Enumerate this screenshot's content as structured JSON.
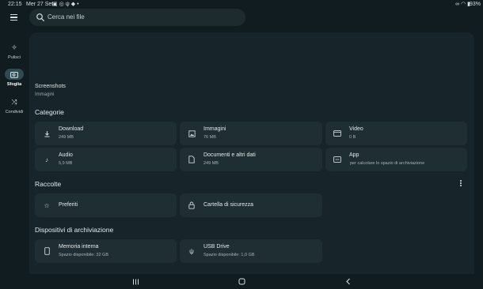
{
  "status_bar": {
    "time": "22:15",
    "date": "Mer 27 Set",
    "battery": "93%"
  },
  "search": {
    "placeholder": "Cerca nei file"
  },
  "rail": {
    "items": [
      {
        "label": "Pulisci",
        "icon": "sparkles-icon"
      },
      {
        "label": "Sfoglia",
        "icon": "browse-folder-icon",
        "active": true
      },
      {
        "label": "Condividi",
        "icon": "share-icon"
      }
    ]
  },
  "screenshots": {
    "title": "Screenshots",
    "subtitle": "Immagini"
  },
  "categorie": {
    "title": "Categorie",
    "items": [
      {
        "label": "Download",
        "sub": "249 MB",
        "icon": "download-icon"
      },
      {
        "label": "Immagini",
        "sub": "76 MB",
        "icon": "image-icon"
      },
      {
        "label": "Video",
        "sub": "0 B",
        "icon": "video-icon"
      },
      {
        "label": "Audio",
        "sub": "5,9 MB",
        "icon": "music-note-icon"
      },
      {
        "label": "Documenti e altri dati",
        "sub": "249 MB",
        "icon": "document-icon"
      },
      {
        "label": "App",
        "sub": "per calcolare lo spazio di archiviazione",
        "icon": "app-icon"
      }
    ]
  },
  "raccolte": {
    "title": "Raccolte",
    "items": [
      {
        "label": "Preferiti",
        "icon": "star-icon"
      },
      {
        "label": "Cartella di sicurezza",
        "icon": "lock-icon"
      }
    ]
  },
  "dispositivi": {
    "title": "Dispositivi di archiviazione",
    "items": [
      {
        "label": "Memoria interna",
        "sub": "Spazio disponibile: 32 GB",
        "icon": "phone-storage-icon"
      },
      {
        "label": "USB Drive",
        "sub": "Spazio disponibile: 1,0 GB",
        "icon": "usb-icon"
      }
    ]
  },
  "colors": {
    "background": "#101c20",
    "panel": "#17252a",
    "card": "#1f2e33",
    "rail_active": "#2e4a52"
  }
}
